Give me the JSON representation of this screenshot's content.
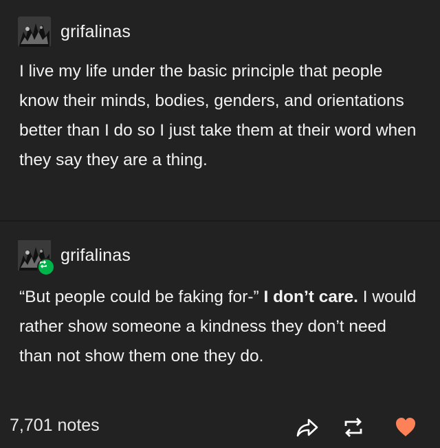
{
  "posts": [
    {
      "username": "grifalinas",
      "body": "I live my life under the basic principle that people know their minds, bodies, genders, and orientations better than I do so I just take them at their word when they say they are a thing."
    },
    {
      "username": "grifalinas",
      "quote": "“But people could be faking for-”",
      "bold_text": "I don’t care.",
      "body": "I would rather show someone a kindness they don’t need than not show them one they do."
    }
  ],
  "footer": {
    "notes": "7,701 notes"
  },
  "icons": {
    "share": "share-icon",
    "reblog": "reblog-icon",
    "like": "heart-icon"
  },
  "colors": {
    "background": "#222222",
    "reblog_badge": "#00b34a",
    "heart": "#ff8157"
  }
}
